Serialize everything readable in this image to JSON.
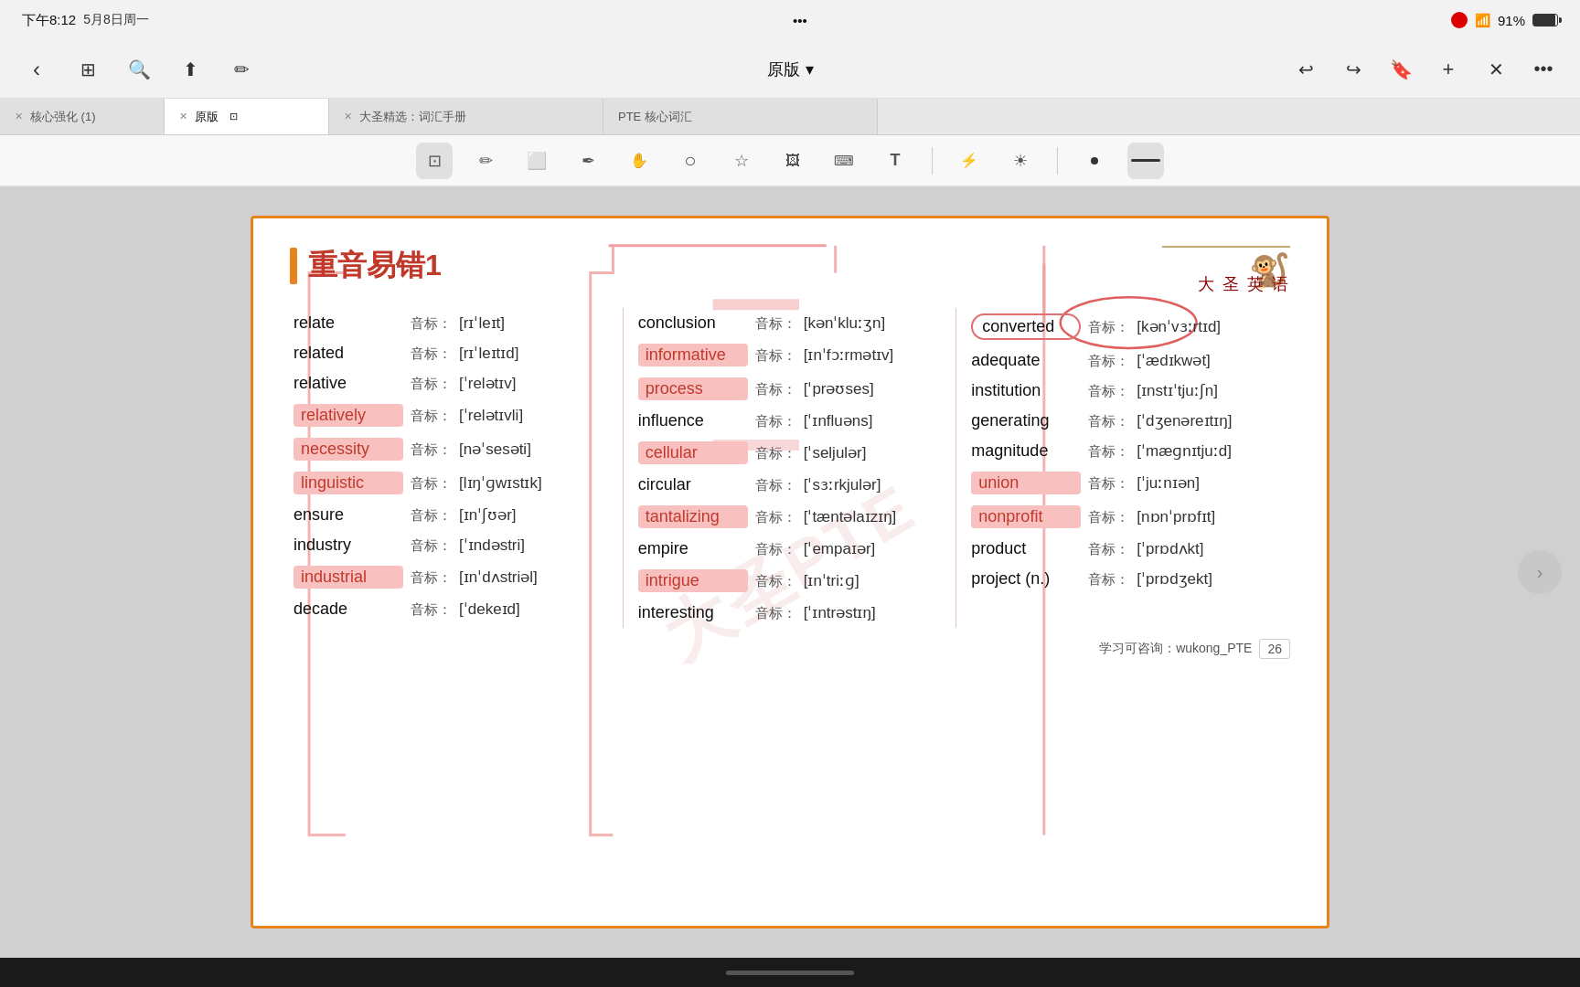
{
  "statusBar": {
    "time": "下午8:12",
    "date": "5月8日周一",
    "battery": "91%",
    "dots": [
      "•",
      "•",
      "•"
    ]
  },
  "toolbar": {
    "title": "原版",
    "dropdown": "▾",
    "backBtn": "‹",
    "forwardBtn": "›",
    "bookmarkBtn": "🔖",
    "addBtn": "+",
    "closeBtn": "✕",
    "moreBtn": "•••",
    "gridBtn": "⊞",
    "searchBtn": "🔍",
    "shareBtn": "⬆",
    "penBtn": "✏"
  },
  "tabs": [
    {
      "label": "核心强化 (1)",
      "active": false,
      "closeable": true
    },
    {
      "label": "原版",
      "active": true,
      "closeable": true
    },
    {
      "label": "大圣精选：词汇手册",
      "active": false,
      "closeable": true
    },
    {
      "label": "PTE 核心词汇",
      "active": false,
      "closeable": false
    }
  ],
  "drawTools": [
    {
      "name": "camera-tool",
      "icon": "⊡"
    },
    {
      "name": "pen-tool",
      "icon": "✏"
    },
    {
      "name": "eraser-tool",
      "icon": "⬜"
    },
    {
      "name": "highlight-tool",
      "icon": "✒"
    },
    {
      "name": "hand-tool",
      "icon": "✋"
    },
    {
      "name": "lasso-tool",
      "icon": "○"
    },
    {
      "name": "star-tool",
      "icon": "☆"
    },
    {
      "name": "image-tool",
      "icon": "🖼"
    },
    {
      "name": "keyboard-tool",
      "icon": "⌨"
    },
    {
      "name": "text-tool",
      "icon": "T"
    },
    {
      "name": "bluetooth-tool",
      "icon": "⚡"
    },
    {
      "name": "dot-tool",
      "icon": "•"
    },
    {
      "name": "line-tool",
      "icon": "—"
    }
  ],
  "page": {
    "title": "重音易错1",
    "brandName": "大 圣 英 语",
    "watermark": "大圣PTE",
    "pageNum": "26",
    "contactInfo": "学习可咨询：wukong_PTE",
    "columns": [
      {
        "rows": [
          {
            "word": "relate",
            "phonetic": "[rɪˈleɪt]"
          },
          {
            "word": "related",
            "phonetic": "[rɪˈleɪtɪd]"
          },
          {
            "word": "relative",
            "phonetic": "[ˈrelətɪv]"
          },
          {
            "word": "relatively",
            "phonetic": "[ˈrelətɪvli]",
            "highlight": true
          },
          {
            "word": "necessity",
            "phonetic": "[nəˈsesəti]",
            "highlight": true
          },
          {
            "word": "linguistic",
            "phonetic": "[lɪŋˈɡwɪstɪk]",
            "highlight": true
          },
          {
            "word": "ensure",
            "phonetic": "[ɪnˈʃʊər]"
          },
          {
            "word": "industry",
            "phonetic": "[ˈɪndəstri]"
          },
          {
            "word": "industrial",
            "phonetic": "[ɪnˈdʌstriəl]",
            "highlight": true
          },
          {
            "word": "decade",
            "phonetic": "[ˈdekeɪd]"
          }
        ]
      },
      {
        "rows": [
          {
            "word": "conclusion",
            "phonetic": "[kənˈkluːʒn]"
          },
          {
            "word": "informative",
            "phonetic": "[ɪnˈfɔːrmətɪv]",
            "highlight": true
          },
          {
            "word": "process",
            "phonetic": "[ˈprəʊses]",
            "highlight": true
          },
          {
            "word": "influence",
            "phonetic": "[ˈɪnfluəns]"
          },
          {
            "word": "cellular",
            "phonetic": "[ˈseljulər]",
            "highlight": true
          },
          {
            "word": "circular",
            "phonetic": "[ˈsɜːrkjulər]"
          },
          {
            "word": "tantalizing",
            "phonetic": "[ˈtæntəlaɪzɪŋ]",
            "highlight": true
          },
          {
            "word": "empire",
            "phonetic": "[ˈempaɪər]"
          },
          {
            "word": "intrigue",
            "phonetic": "[ɪnˈtriːɡ]",
            "highlight": true
          },
          {
            "word": "interesting",
            "phonetic": "[ˈɪntrəstɪŋ]"
          }
        ]
      },
      {
        "rows": [
          {
            "word": "converted",
            "phonetic": "[kənˈvɜːrtɪd]",
            "circle": true
          },
          {
            "word": "adequate",
            "phonetic": "[ˈædɪkwət]"
          },
          {
            "word": "institution",
            "phonetic": "[ɪnstɪˈtjuːʃn]"
          },
          {
            "word": "generating",
            "phonetic": "[ˈdʒenəreɪtɪŋ]"
          },
          {
            "word": "magnitude",
            "phonetic": "[ˈmæɡnɪtjuːd]"
          },
          {
            "word": "union",
            "phonetic": "[ˈjuːnɪən]",
            "highlight": true
          },
          {
            "word": "nonprofit",
            "phonetic": "[nɒnˈprɒfɪt]",
            "highlight": true
          },
          {
            "word": "product",
            "phonetic": "[ˈprɒdʌkt]"
          },
          {
            "word": "project (n.)",
            "phonetic": "[ˈprɒdʒekt]"
          }
        ]
      }
    ]
  }
}
